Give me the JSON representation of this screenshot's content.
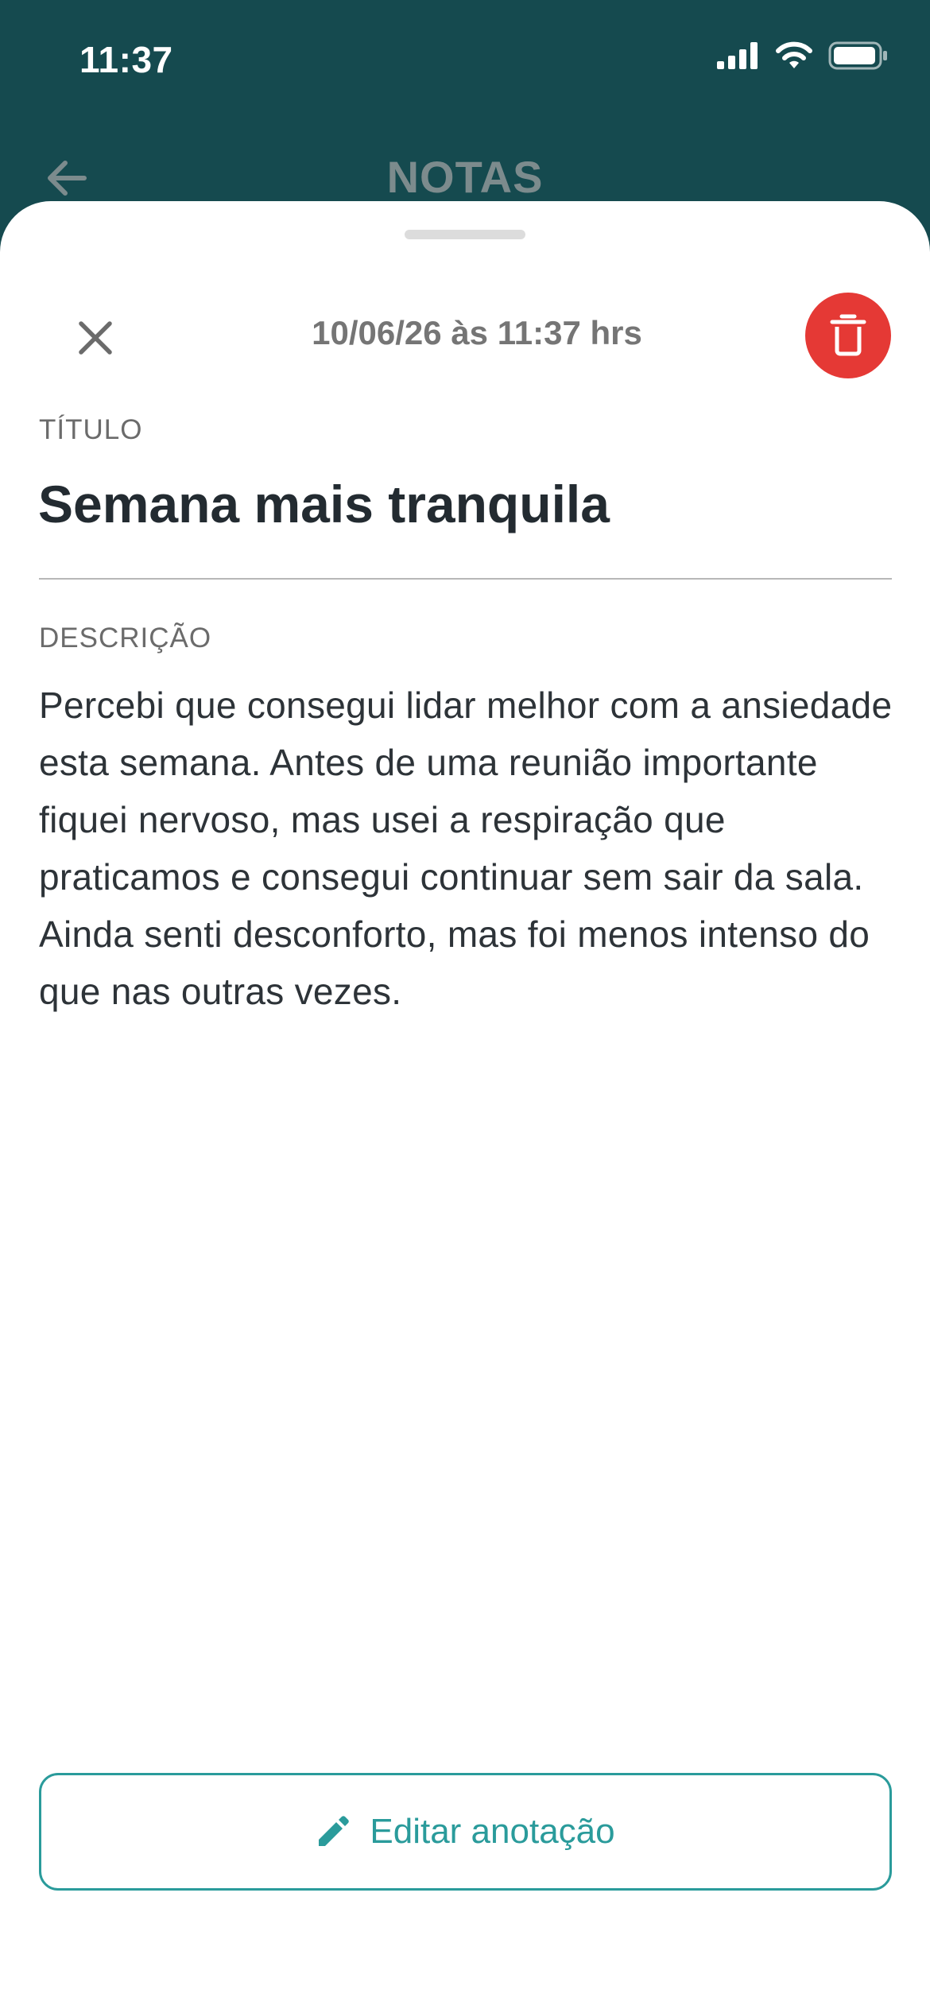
{
  "status_bar": {
    "time": "11:37",
    "icons": [
      "cellular-signal-icon",
      "wifi-icon",
      "battery-icon"
    ]
  },
  "header": {
    "title": "NOTAS",
    "back_icon": "arrow-left-icon"
  },
  "sheet": {
    "date": "10/06/26 às 11:37 hrs",
    "close_icon": "close-icon",
    "delete_icon": "trash-icon",
    "title_label": "TÍTULO",
    "title_value": "Semana mais tranquila",
    "description_label": "DESCRIÇÃO",
    "description_value": "Percebi que consegui lidar melhor com a ansiedade esta semana. Antes de uma reunião importante fiquei nervoso, mas usei a respiração que praticamos e consegui continuar sem sair da sala. Ainda senti desconforto, mas foi menos intenso do que nas outras vezes.",
    "edit_button_label": "Editar anotação",
    "edit_icon": "pencil-icon"
  },
  "colors": {
    "header_bg": "#154a4f",
    "accent": "#2a9b9b",
    "delete": "#e53935"
  }
}
